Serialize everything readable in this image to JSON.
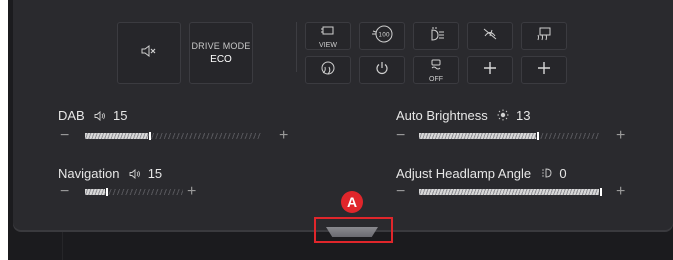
{
  "quick_tiles": {
    "mute_icon": "speaker-mute-icon",
    "drive_mode": {
      "label": "DRIVE MODE",
      "value": "ECO"
    }
  },
  "function_tiles": [
    {
      "icon": "camera-view-icon",
      "label": "VIEW"
    },
    {
      "icon": "speed-100-icon",
      "label": ""
    },
    {
      "icon": "headlamp-washer-icon",
      "label": ""
    },
    {
      "icon": "no-wiper-icon",
      "label": ""
    },
    {
      "icon": "rear-defrost-icon",
      "label": ""
    },
    {
      "icon": "steering-heat-icon",
      "label": ""
    },
    {
      "icon": "power-icon",
      "label": ""
    },
    {
      "icon": "traction-off-icon",
      "label": "OFF"
    },
    {
      "icon": "add-icon",
      "label": ""
    },
    {
      "icon": "add-icon",
      "label": ""
    }
  ],
  "controls": {
    "dab": {
      "label": "DAB",
      "icon": "volume-icon",
      "value": "15",
      "level": 0.36
    },
    "navigation": {
      "label": "Navigation",
      "icon": "volume-icon",
      "value": "15",
      "level": 0.2
    },
    "auto_brightness": {
      "label": "Auto Brightness",
      "icon": "brightness-icon",
      "value": "13",
      "level": 0.65
    },
    "headlamp_angle": {
      "label": "Adjust Headlamp Angle",
      "icon": "headlamp-level-icon",
      "value": "0",
      "level": 1.0
    }
  },
  "annotation": {
    "badge": "A",
    "color": "#e0262b"
  }
}
